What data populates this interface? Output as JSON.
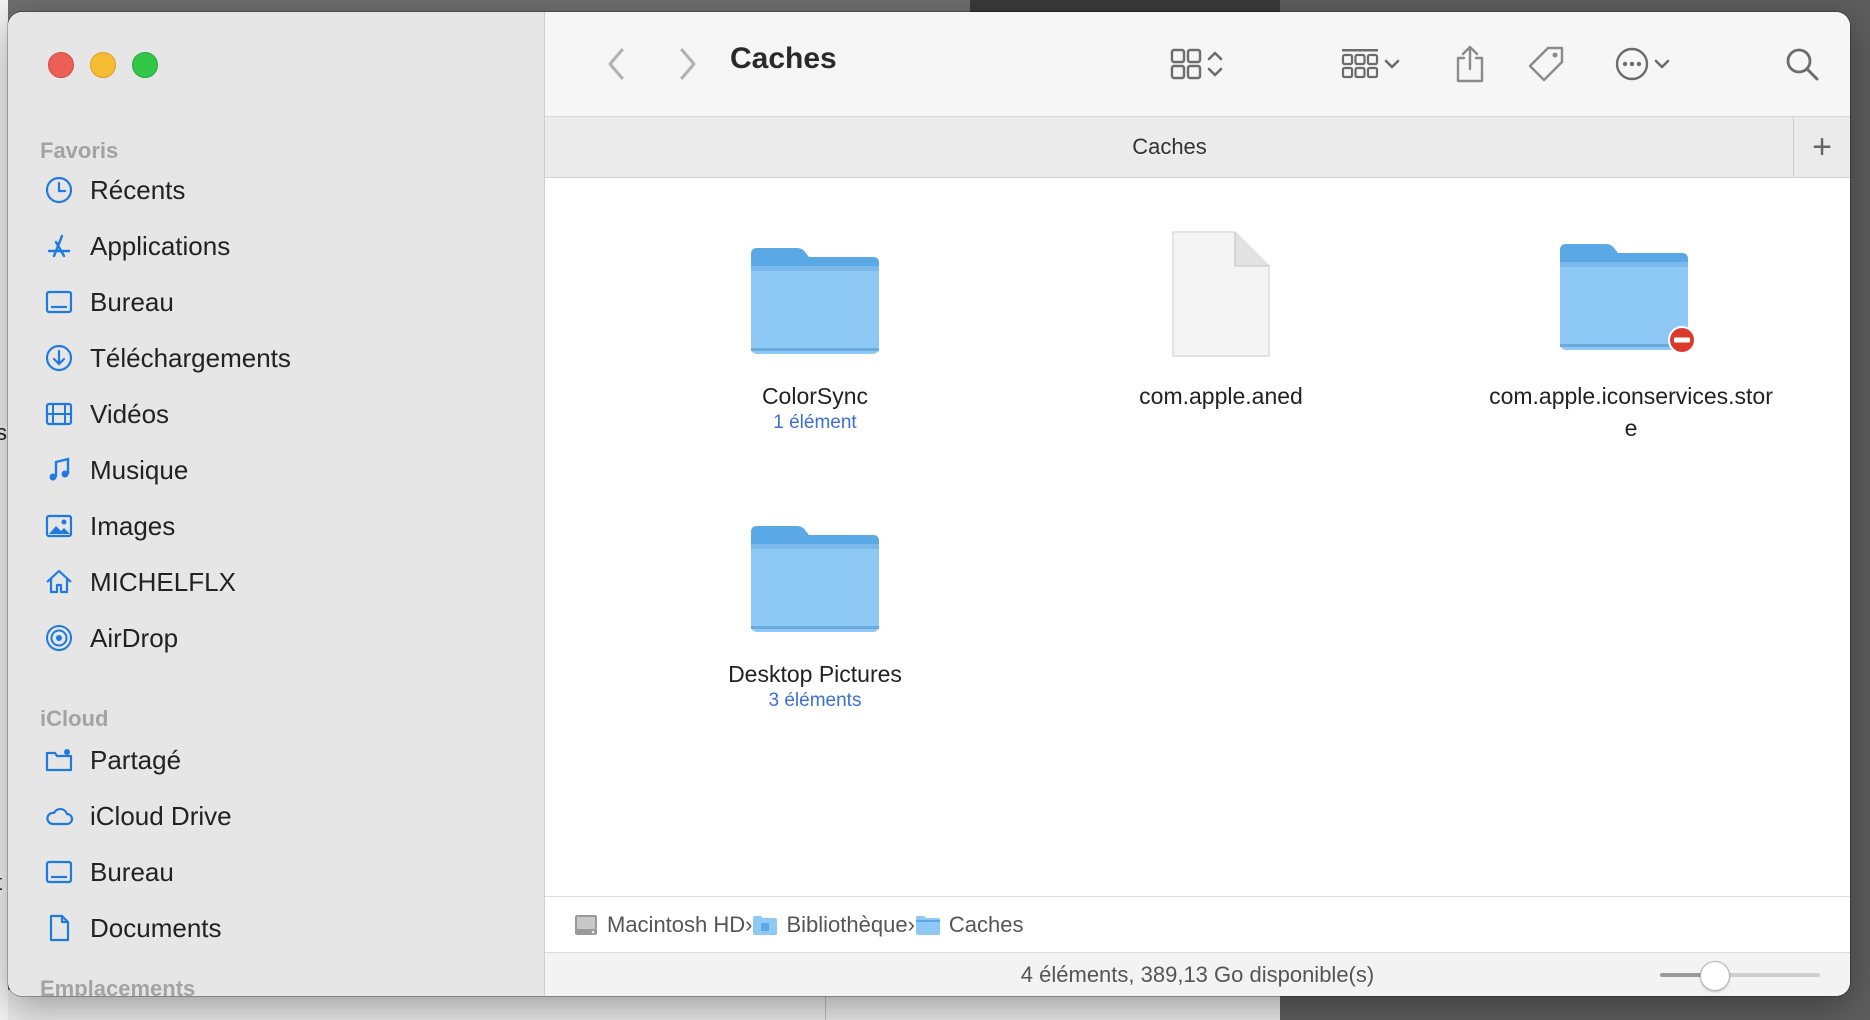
{
  "window": {
    "title": "Caches"
  },
  "sidebar": {
    "sections": [
      {
        "title": "Favoris",
        "items": [
          {
            "label": "Récents",
            "icon": "clock-icon"
          },
          {
            "label": "Applications",
            "icon": "applications-icon"
          },
          {
            "label": "Bureau",
            "icon": "desktop-icon"
          },
          {
            "label": "Téléchargements",
            "icon": "download-icon"
          },
          {
            "label": "Vidéos",
            "icon": "film-icon"
          },
          {
            "label": "Musique",
            "icon": "music-icon"
          },
          {
            "label": "Images",
            "icon": "photo-icon"
          },
          {
            "label": "MICHELFLX",
            "icon": "home-icon"
          },
          {
            "label": "AirDrop",
            "icon": "airdrop-icon"
          }
        ]
      },
      {
        "title": "iCloud",
        "items": [
          {
            "label": "Partagé",
            "icon": "shared-folder-icon"
          },
          {
            "label": "iCloud Drive",
            "icon": "cloud-icon"
          },
          {
            "label": "Bureau",
            "icon": "desktop-icon"
          },
          {
            "label": "Documents",
            "icon": "document-icon"
          }
        ]
      },
      {
        "title": "Emplacements",
        "items": []
      }
    ]
  },
  "tabs": [
    {
      "label": "Caches"
    }
  ],
  "files": [
    {
      "name": "ColorSync",
      "sub": "1 élément",
      "kind": "folder"
    },
    {
      "name": "com.apple.aned",
      "sub": "",
      "kind": "file"
    },
    {
      "name": "com.apple.iconservices.stor\ne",
      "sub": "",
      "kind": "folder-restricted"
    },
    {
      "name": "Desktop Pictures",
      "sub": "3 éléments",
      "kind": "folder"
    }
  ],
  "pathbar": [
    {
      "label": "Macintosh HD",
      "icon": "hard-drive-icon"
    },
    {
      "label": "Bibliothèque",
      "icon": "library-folder-icon"
    },
    {
      "label": "Caches",
      "icon": "folder-icon"
    }
  ],
  "status": {
    "text": "4 éléments, 389,13 Go disponible(s)",
    "zoom": 0.3
  },
  "colors": {
    "accent": "#1f7ae0",
    "folder": "#8ec9f5",
    "folder_tab": "#5aa8e6",
    "restricted": "#d93a2b",
    "sub_text": "#3d6fd9"
  }
}
